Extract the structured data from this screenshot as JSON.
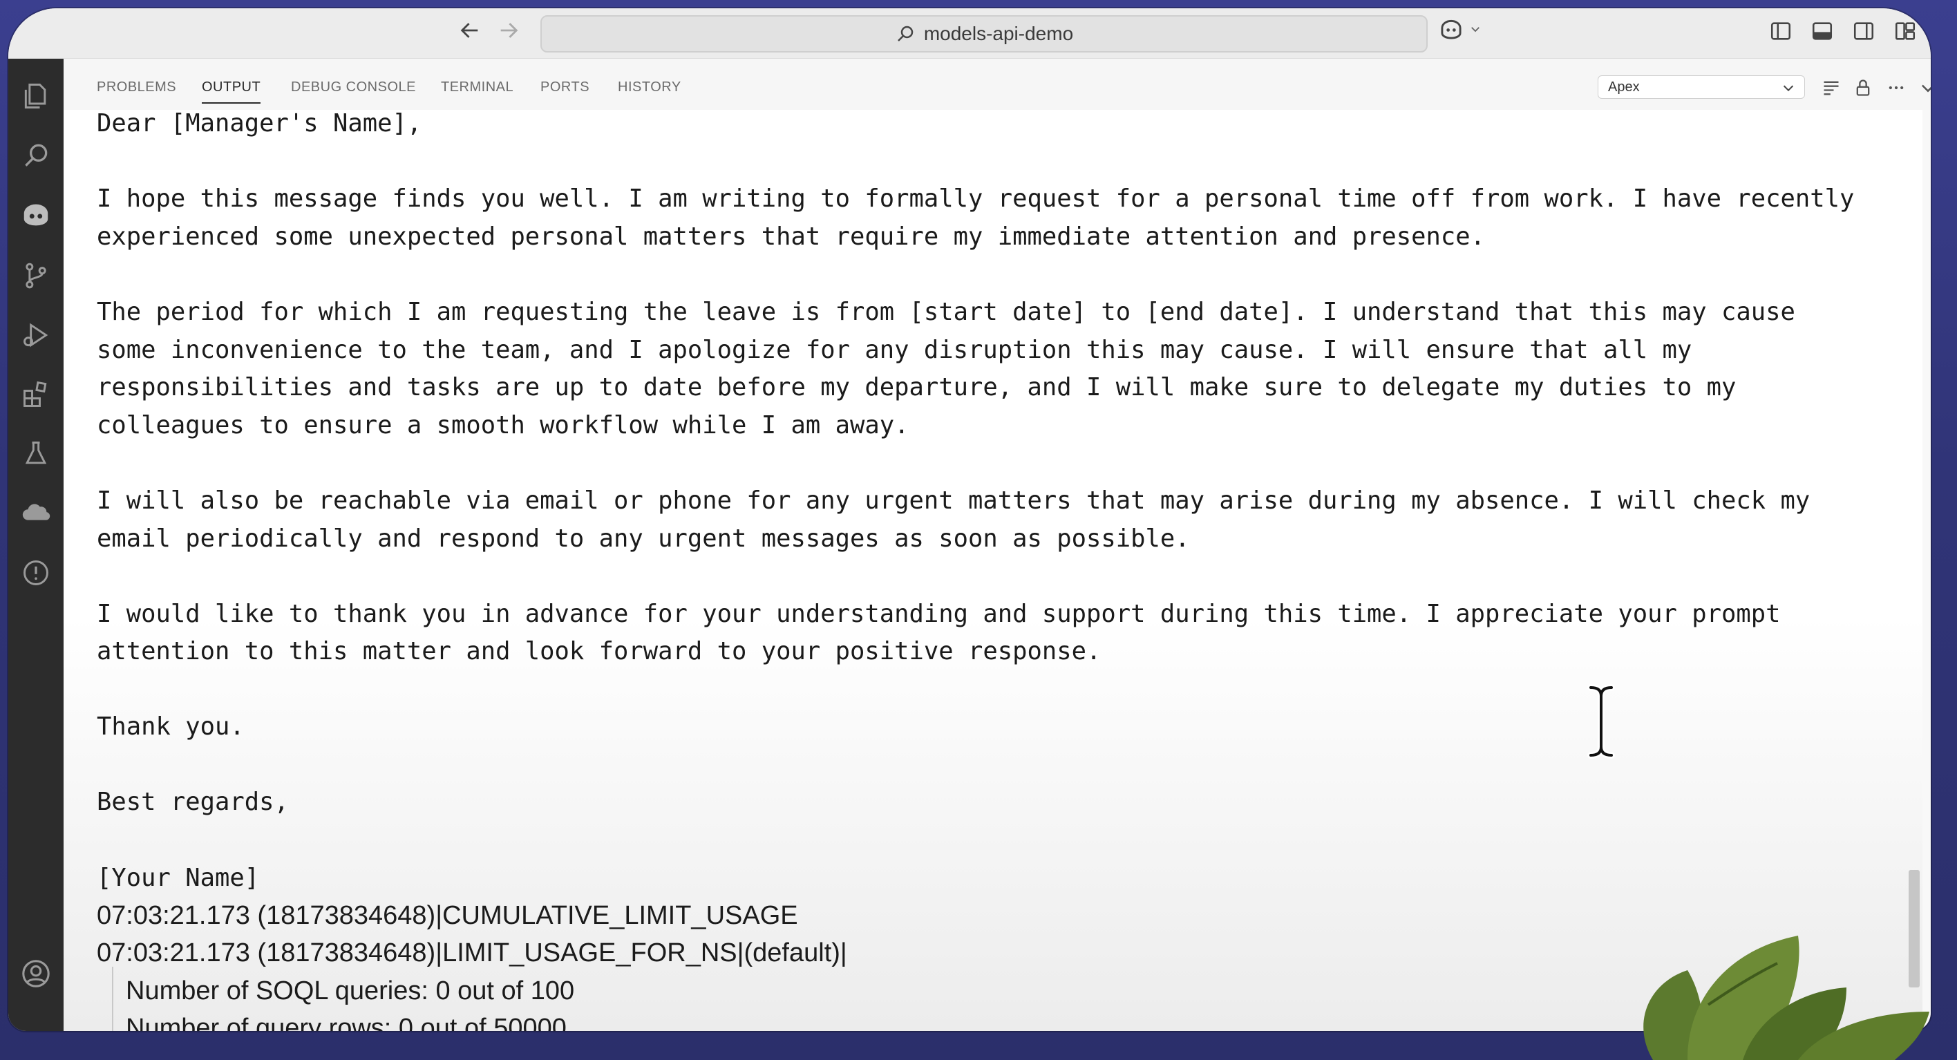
{
  "titlebar": {
    "search_text": "models-api-demo"
  },
  "panel": {
    "tabs": [
      "PROBLEMS",
      "OUTPUT",
      "DEBUG CONSOLE",
      "TERMINAL",
      "PORTS",
      "HISTORY"
    ],
    "active_tab": "OUTPUT",
    "channel_select": "Apex"
  },
  "output": {
    "letter": [
      "Dear [Manager's Name],",
      "I hope this message finds you well. I am writing to formally request for a personal time off from work. I have recently",
      "experienced some unexpected personal matters that require my immediate attention and presence.",
      "The period for which I am requesting the leave is from [start date] to [end date]. I understand that this may cause",
      "some inconvenience to the team, and I apologize for any disruption this may cause. I will ensure that all my",
      "responsibilities and tasks are up to date before my departure, and I will make sure to delegate my duties to my",
      "colleagues to ensure a smooth workflow while I am away.",
      "I will also be reachable via email or phone for any urgent matters that may arise during my absence. I will check my",
      "email periodically and respond to any urgent messages as soon as possible.",
      "I would like to thank you in advance for your understanding and support during this time. I appreciate your prompt",
      "attention to this matter and look forward to your positive response.",
      "Thank you.",
      "Best regards,",
      "[Your Name]"
    ],
    "log": [
      "07:03:21.173 (18173834648)|CUMULATIVE_LIMIT_USAGE",
      "07:03:21.173 (18173834648)|LIMIT_USAGE_FOR_NS|(default)|",
      "Number of SOQL queries: 0 out of 100",
      "Number of query rows: 0 out of 50000"
    ]
  },
  "colors": {
    "activity_bar": "#2c2c2c",
    "background": "#2f3374",
    "text": "#1b1b1b"
  }
}
